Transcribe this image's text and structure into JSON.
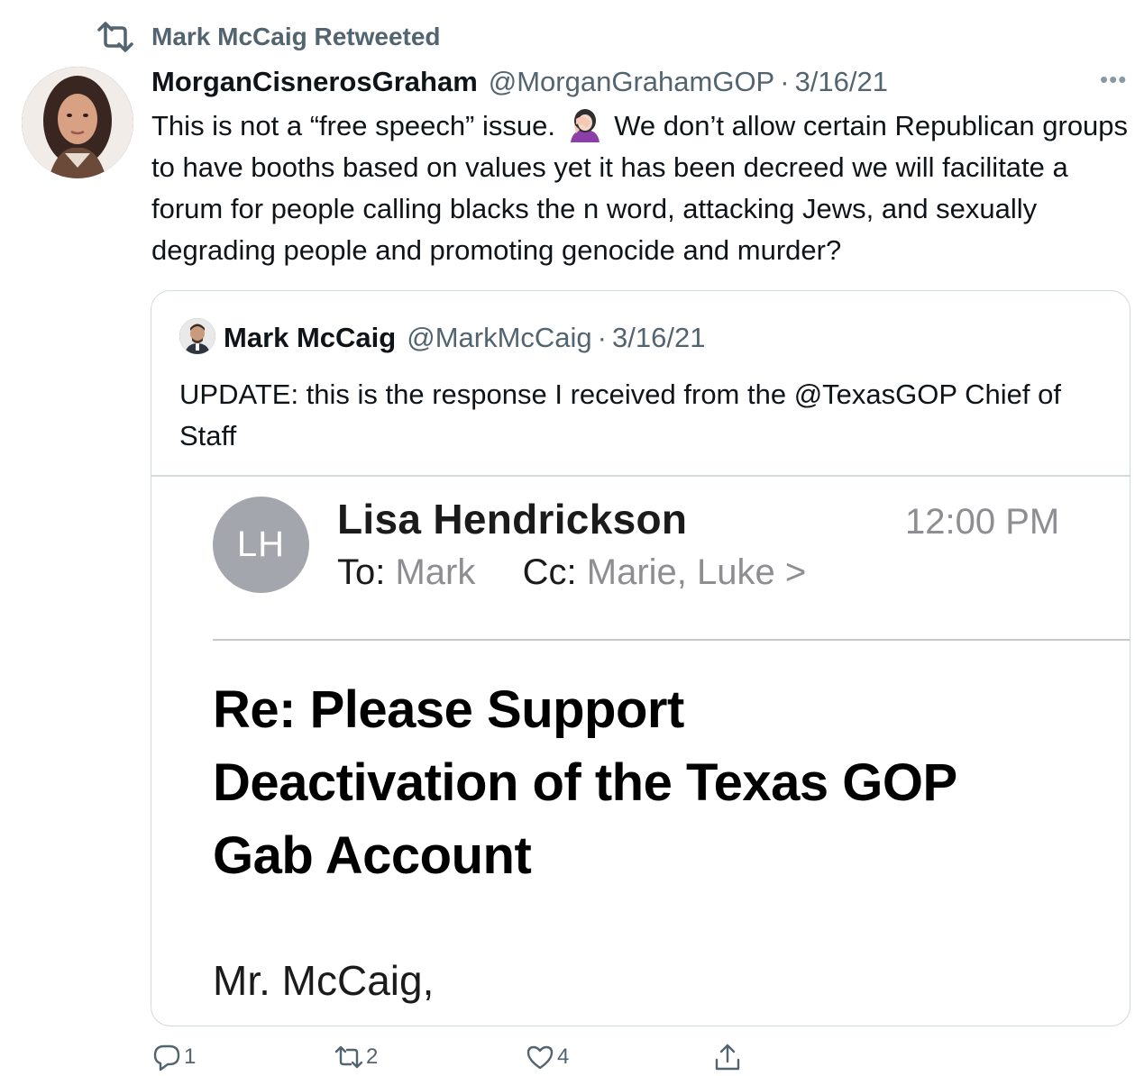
{
  "retweet_banner": {
    "label": "Mark McCaig Retweeted"
  },
  "tweet": {
    "author_name": "MorganCisnerosGraham",
    "author_handle": "@MorganGrahamGOP",
    "separator": "·",
    "date": "3/16/21",
    "text_before_emoji": "This is not a “free speech” issue.",
    "emoji": "woman-facepalming-emoji",
    "text_after_emoji": "We don’t allow certain Republican groups to have booths based on values yet it has been decreed we will facilitate a forum for people calling blacks the n word, attacking Jews, and sexually degrading people and promoting genocide and murder?"
  },
  "quoted_tweet": {
    "author_name": "Mark McCaig",
    "author_handle": "@MarkMcCaig",
    "separator": "·",
    "date": "3/16/21",
    "text": "UPDATE: this is the response I received from the @TexasGOP Chief of Staff",
    "email_image": {
      "avatar_initials": "LH",
      "from": "Lisa Hendrickson",
      "time": "12:00 PM",
      "to_label": "To:",
      "to_value": "Mark",
      "cc_label": "Cc:",
      "cc_value": "Marie, Luke",
      "chevron": ">",
      "subject_line1": "Re: Please Support",
      "subject_line2": "Deactivation of the Texas GOP",
      "subject_line3": "Gab Account",
      "greeting": "Mr. McCaig,"
    }
  },
  "actions": {
    "reply_count": "1",
    "retweet_count": "2",
    "like_count": "4"
  },
  "colors": {
    "secondary_text": "#536471",
    "border": "#cfd9de",
    "email_avatar": "#a4a6ae"
  }
}
